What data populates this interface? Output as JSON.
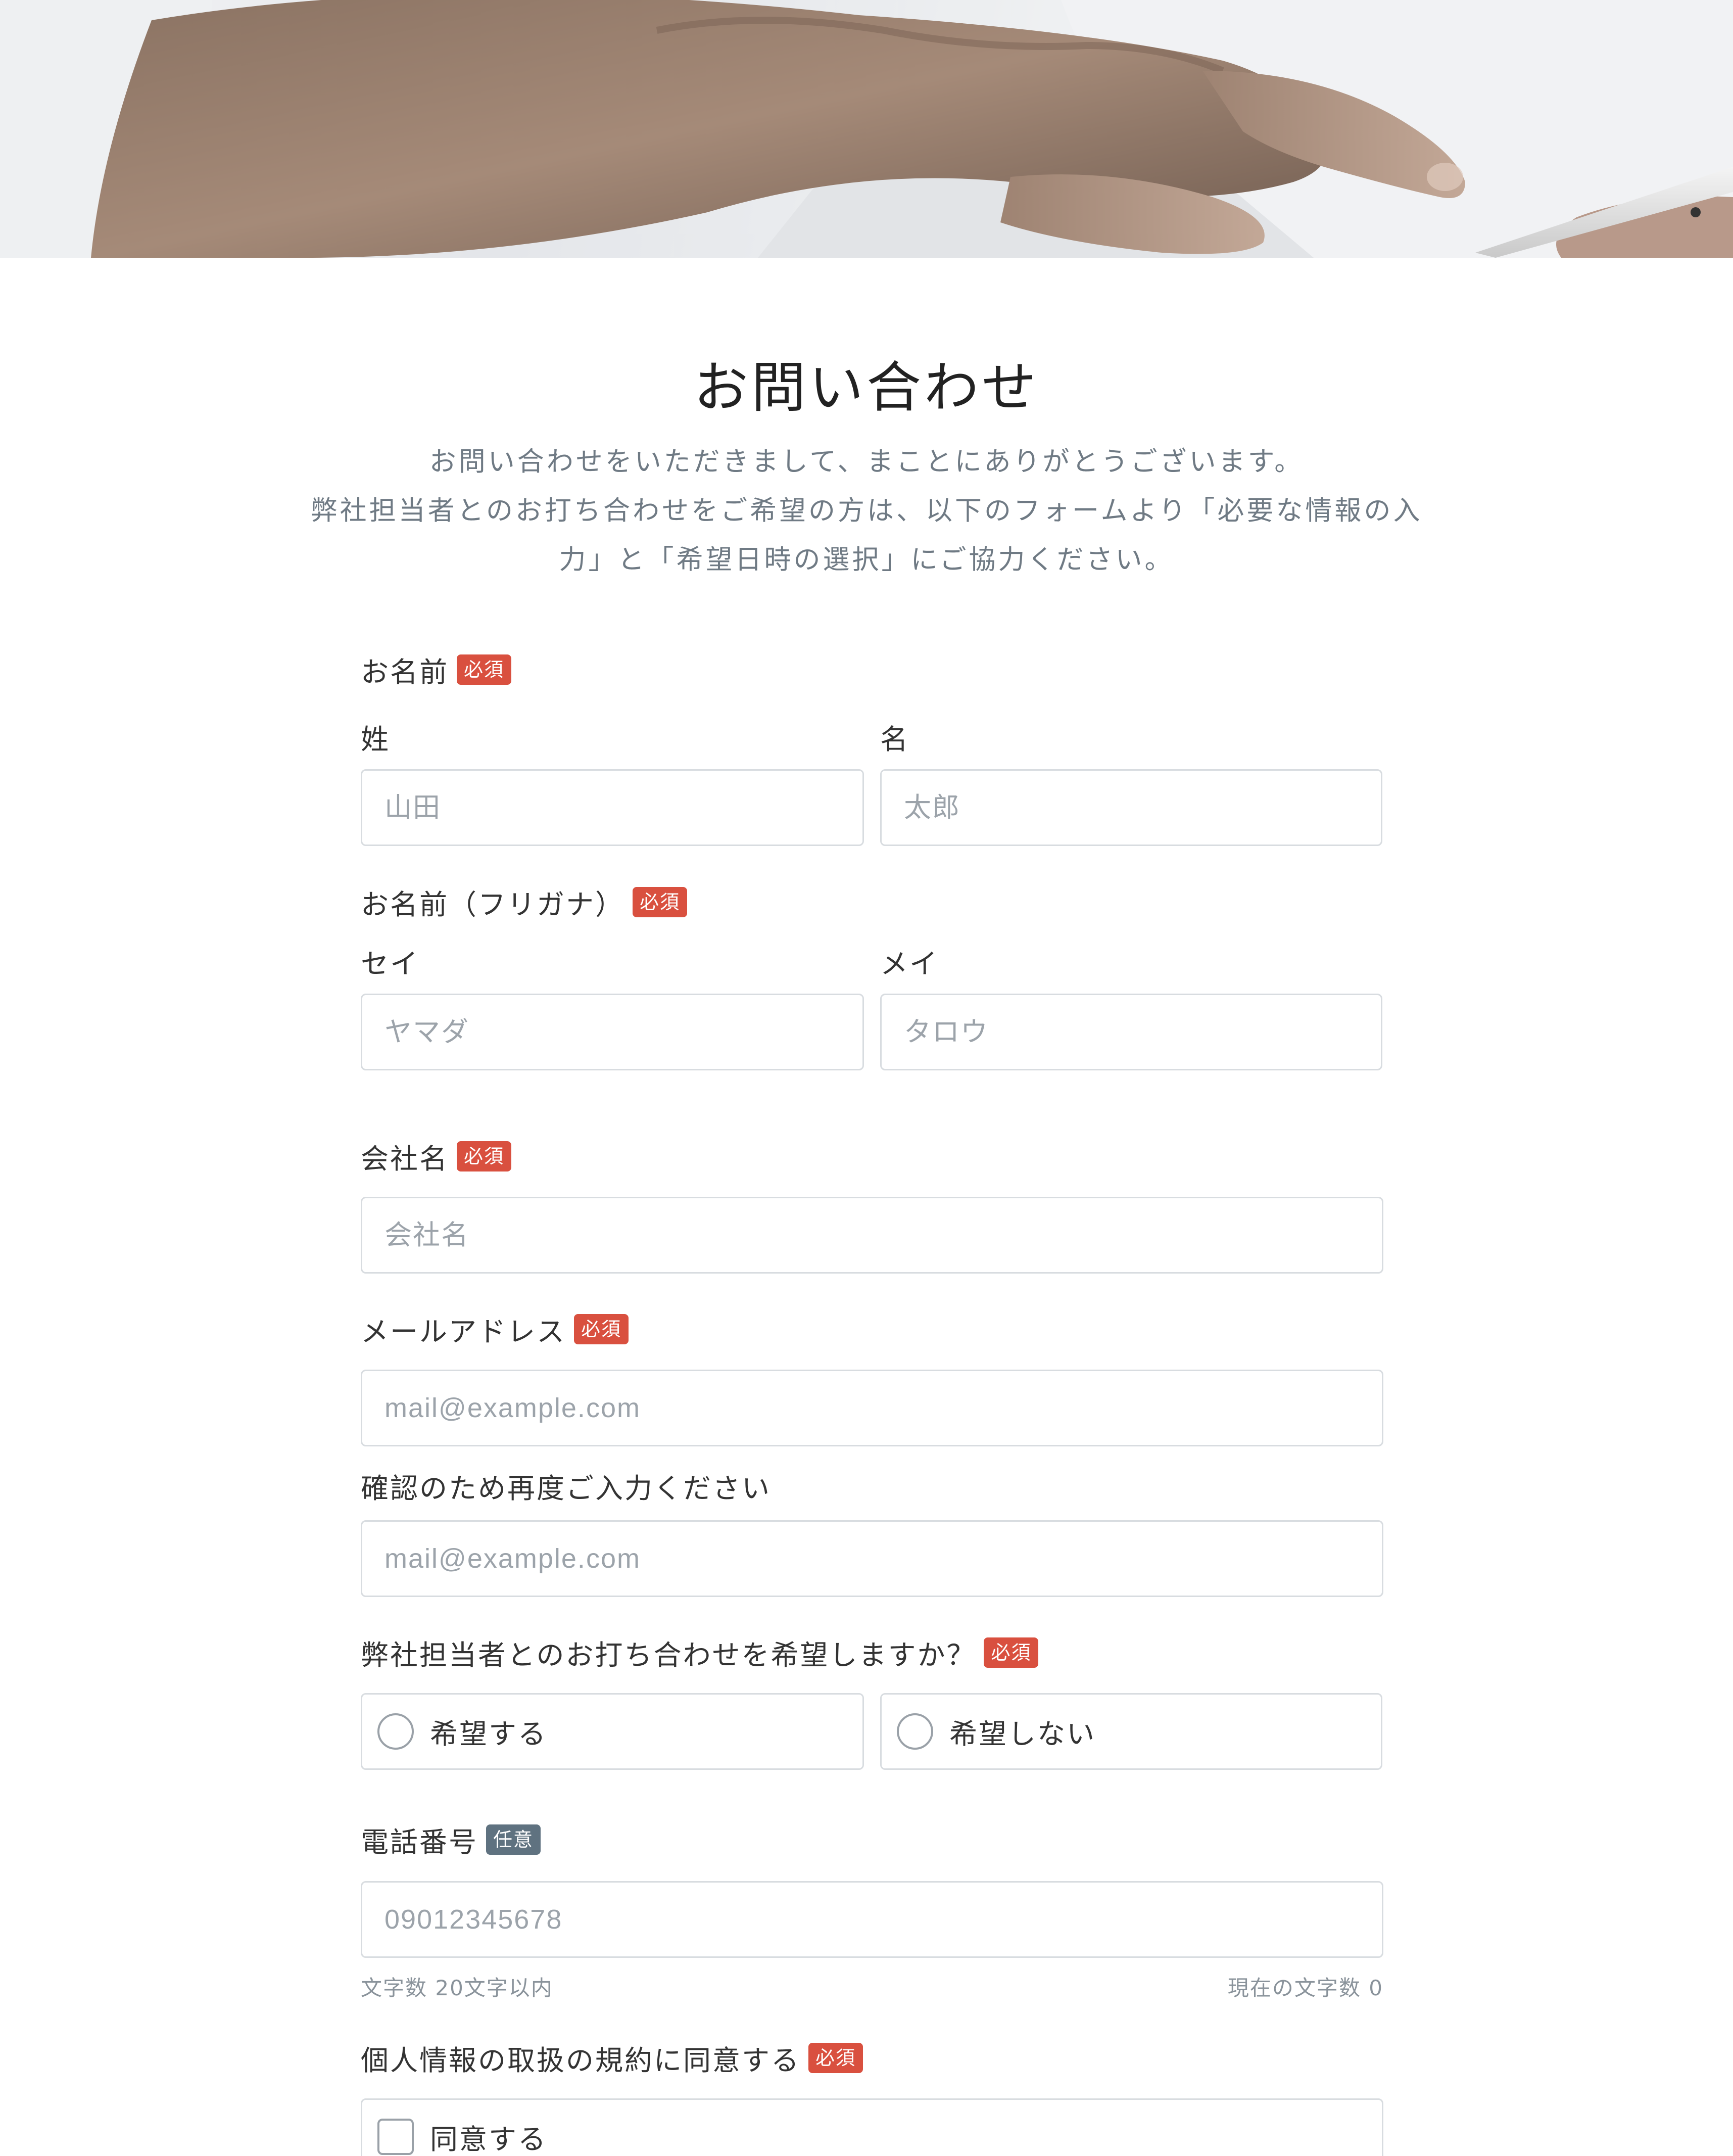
{
  "header": {
    "title": "お問い合わせ",
    "intro_lines": [
      "お問い合わせをいただきまして、まことにありがとうございます。",
      "弊社担当者とのお打ち合わせをご希望の方は、以下のフォームより「必要な情報の入",
      "力」と「希望日時の選択」にご協力ください。"
    ]
  },
  "badges": {
    "required": "必須",
    "optional": "任意"
  },
  "form": {
    "name": {
      "label": "お名前",
      "last_label": "姓",
      "last_placeholder": "山田",
      "first_label": "名",
      "first_placeholder": "太郎"
    },
    "furigana": {
      "label": "お名前（フリガナ）",
      "last_label": "セイ",
      "last_placeholder": "ヤマダ",
      "first_label": "メイ",
      "first_placeholder": "タロウ"
    },
    "company": {
      "label": "会社名",
      "placeholder": "会社名"
    },
    "email": {
      "label": "メールアドレス",
      "placeholder": "mail@example.com"
    },
    "email_confirm": {
      "label": "確認のため再度ご入力ください",
      "placeholder": "mail@example.com"
    },
    "meeting": {
      "label": "弊社担当者とのお打ち合わせを希望しますか？",
      "options": [
        "希望する",
        "希望しない"
      ]
    },
    "phone": {
      "label": "電話番号",
      "placeholder": "09012345678",
      "limit_text": "文字数 20文字以内",
      "count_text": "現在の文字数 0"
    },
    "privacy": {
      "label": "個人情報の取扱の規約に同意する",
      "option": "同意する"
    }
  },
  "colors": {
    "required_badge": "#d9503f",
    "optional_badge": "#5f7280",
    "intro_text": "#6f7a84"
  }
}
